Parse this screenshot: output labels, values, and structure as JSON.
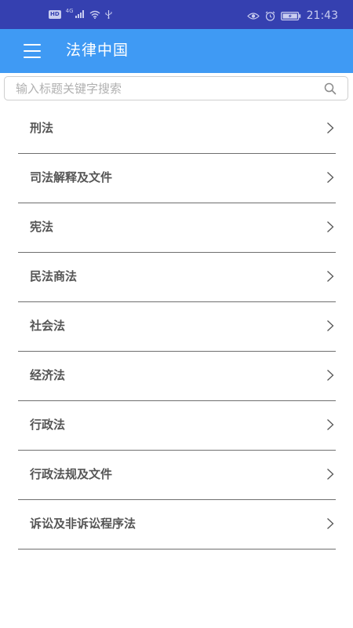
{
  "status_bar": {
    "hd": "HD",
    "network": "4G",
    "time": "21:43"
  },
  "app_bar": {
    "title": "法律中国",
    "menu_icon": "hamburger-menu-icon"
  },
  "search": {
    "placeholder": "输入标题关键字搜索",
    "value": "",
    "icon": "search-icon"
  },
  "categories": [
    {
      "label": "刑法"
    },
    {
      "label": "司法解释及文件"
    },
    {
      "label": "宪法"
    },
    {
      "label": "民法商法"
    },
    {
      "label": "社会法"
    },
    {
      "label": "经济法"
    },
    {
      "label": "行政法"
    },
    {
      "label": "行政法规及文件"
    },
    {
      "label": "诉讼及非诉讼程序法"
    }
  ],
  "colors": {
    "status_bar": "#3540b0",
    "app_bar": "#3f9af4",
    "item_text": "#555555",
    "divider": "#6f6f6f"
  }
}
